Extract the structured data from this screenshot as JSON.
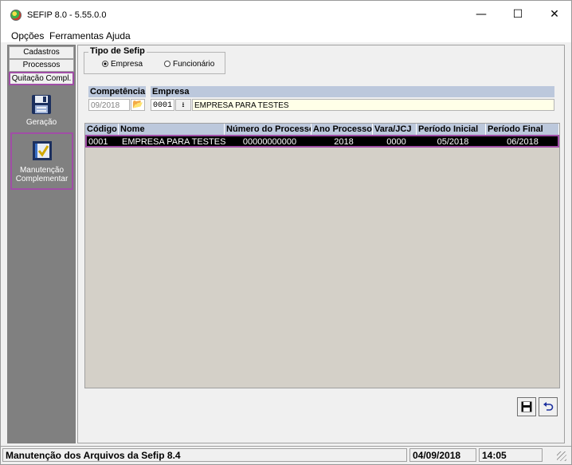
{
  "window": {
    "title": "SEFIP 8.0 - 5.55.0.0",
    "controls": {
      "minimize": "—",
      "maximize": "☐",
      "close": "✕"
    }
  },
  "menu": [
    "Opções",
    "Ferramentas",
    "Ajuda"
  ],
  "nav": {
    "tabs": [
      "Cadastros",
      "Processos",
      "Quitação Compl."
    ],
    "active_tab": "Quitação Compl.",
    "tools": [
      {
        "label": "Geração",
        "icon": "floppy-disk-icon"
      },
      {
        "label_line1": "Manutenção",
        "label_line2": "Complementar",
        "icon": "notebook-check-icon"
      }
    ]
  },
  "tipo_sefip": {
    "label": "Tipo de Sefip",
    "options": [
      "Empresa",
      "Funcionário"
    ],
    "selected": "Empresa"
  },
  "competencia": {
    "label": "Competência",
    "value": "09/2018"
  },
  "empresa": {
    "label": "Empresa",
    "code": "0001",
    "name": "EMPRESA PARA TESTES"
  },
  "grid": {
    "columns": [
      "Código",
      "Nome",
      "Número do Processo",
      "Ano Processo",
      "Vara/JCJ",
      "Período Inicial",
      "Período Final"
    ],
    "rows": [
      [
        "0001",
        "EMPRESA PARA TESTES",
        "00000000000",
        "2018",
        "0000",
        "05/2018",
        "06/2018"
      ]
    ]
  },
  "buttons": {
    "save": "save-icon",
    "undo": "undo-icon"
  },
  "status": {
    "message": "Manutenção dos Arquivos da Sefip 8.4",
    "date": "04/09/2018",
    "time": "14:05"
  },
  "colors": {
    "highlight": "#a04ea6",
    "header_bg": "#bcc8dc",
    "selected_row": "#000000",
    "nav_bg": "#808080"
  }
}
